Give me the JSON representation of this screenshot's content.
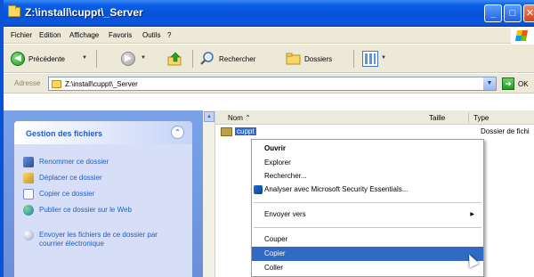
{
  "window": {
    "title": "Z:\\install\\cuppt\\_Server"
  },
  "menubar": {
    "items": [
      "Fichier",
      "Edition",
      "Affichage",
      "Favoris",
      "Outils",
      "?"
    ]
  },
  "toolbar": {
    "back_label": "Précédente",
    "search_label": "Rechercher",
    "folders_label": "Dossiers",
    "icons": [
      "back-arrow",
      "forward-arrow",
      "up-folder",
      "search-magnifier",
      "folders",
      "views-grid"
    ]
  },
  "address": {
    "label": "Adresse",
    "value": "Z:\\install\\cuppt\\_Server",
    "go_label": "OK"
  },
  "taskpane": {
    "title": "Gestion des fichiers",
    "items": [
      {
        "label": "Renommer ce dossier",
        "icon": "rename-icon"
      },
      {
        "label": "Déplacer ce dossier",
        "icon": "move-icon"
      },
      {
        "label": "Copier ce dossier",
        "icon": "copy-icon"
      },
      {
        "label": "Publier ce dossier sur le Web",
        "icon": "globe-icon"
      },
      {
        "label": "Envoyer les fichiers de ce dossier par courrier électronique",
        "icon": "mail-icon"
      }
    ]
  },
  "filelist": {
    "columns": {
      "name": "Nom",
      "size": "Taille",
      "type": "Type"
    },
    "rows": [
      {
        "name": "cuppt",
        "type": "Dossier de fichi"
      }
    ]
  },
  "context_menu": {
    "items": [
      {
        "label": "Ouvrir",
        "bold": true
      },
      {
        "label": "Explorer"
      },
      {
        "label": "Rechercher..."
      },
      {
        "label": "Analyser avec Microsoft Security Essentials...",
        "icon": "security-essentials-icon"
      },
      {
        "label": "Envoyer vers",
        "submenu": true
      },
      {
        "label": "Couper"
      },
      {
        "label": "Copier",
        "highlighted": true
      },
      {
        "label": "Coller"
      }
    ]
  },
  "colors": {
    "titlebar": "#0454d9",
    "selection": "#316ac5",
    "taskpane_bg": "#6a8fd8",
    "taskpane_link": "#215dc6"
  }
}
